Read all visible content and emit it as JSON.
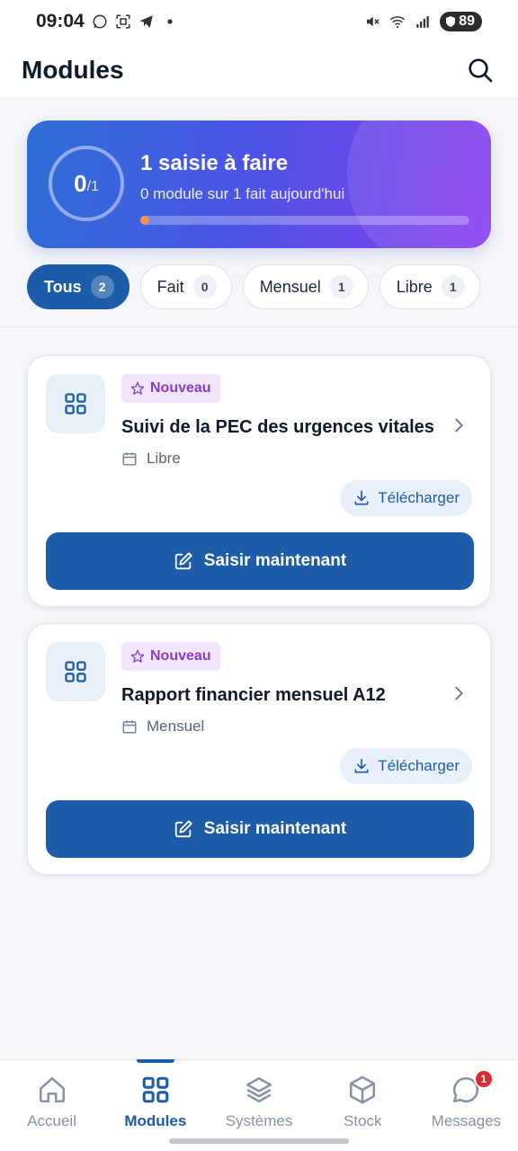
{
  "status_bar": {
    "time": "09:04",
    "battery": "89",
    "icons": [
      "whatsapp-icon",
      "screenshot-icon",
      "telegram-icon",
      "dot-icon",
      "mute-icon",
      "wifi-icon",
      "signal-icon",
      "battery-icon"
    ]
  },
  "header": {
    "title": "Modules",
    "search_icon": "search-icon"
  },
  "progress": {
    "done": "0",
    "total": "/1",
    "title": "1 saisie à faire",
    "subtitle": "0 module sur 1 fait aujourd'hui",
    "fraction": 0,
    "fill_color": "#f5924a"
  },
  "filters": [
    {
      "label": "Tous",
      "count": "2",
      "active": true
    },
    {
      "label": "Fait",
      "count": "0",
      "active": false
    },
    {
      "label": "Mensuel",
      "count": "1",
      "active": false
    },
    {
      "label": "Libre",
      "count": "1",
      "active": false
    }
  ],
  "modules": [
    {
      "badge": "Nouveau",
      "title": "Suivi de la PEC des urgences vitales",
      "frequency": "Libre",
      "download_label": "Télécharger",
      "primary_label": "Saisir maintenant"
    },
    {
      "badge": "Nouveau",
      "title": "Rapport financier mensuel A12",
      "frequency": "Mensuel",
      "download_label": "Télécharger",
      "primary_label": "Saisir maintenant"
    }
  ],
  "bottom_nav": [
    {
      "label": "Accueil",
      "icon": "home-icon",
      "active": false
    },
    {
      "label": "Modules",
      "icon": "grid-icon",
      "active": true
    },
    {
      "label": "Systèmes",
      "icon": "layers-icon",
      "active": false
    },
    {
      "label": "Stock",
      "icon": "box-icon",
      "active": false
    },
    {
      "label": "Messages",
      "icon": "chat-icon",
      "active": false,
      "badge": "1"
    }
  ],
  "colors": {
    "primary": "#1d5ca8",
    "accent_purple": "#8a3cc8",
    "badge_red": "#e0282e"
  }
}
